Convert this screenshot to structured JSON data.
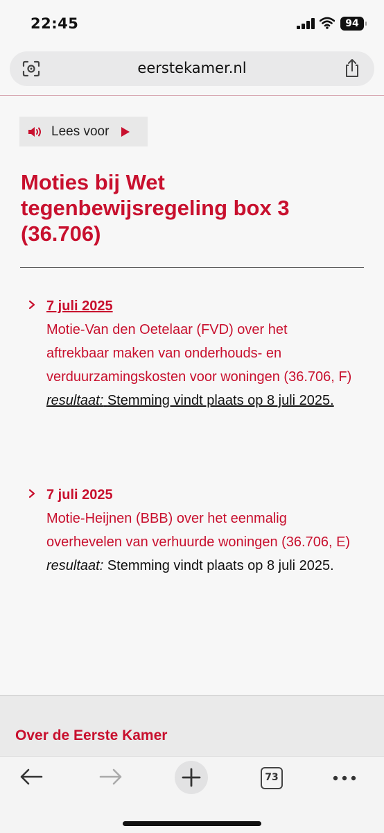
{
  "status_bar": {
    "time": "22:45",
    "battery": "94"
  },
  "browser": {
    "url": "eerstekamer.nl",
    "tab_count": "73"
  },
  "lees_voor": {
    "label": "Lees voor"
  },
  "page": {
    "title": "Moties bij Wet tegenbewijsregeling box 3 (36.706)"
  },
  "moties": [
    {
      "date": "7 juli 2025",
      "description": "Motie-Van den Oetelaar (FVD) over het aftrekbaar maken van onderhouds- en verduurzamingskosten voor woningen (36.706, F)",
      "result_label": "resultaat:",
      "result_text": "Stemming vindt plaats op 8 juli 2025."
    },
    {
      "date": "7 juli 2025",
      "description": "Motie-Heijnen (BBB) over het eenmalig overhevelen van verhuurde woningen (36.706, E)",
      "result_label": "resultaat:",
      "result_text": "Stemming vindt plaats op 8 juli 2025."
    }
  ],
  "footer": {
    "link": "Over de Eerste Kamer"
  },
  "colors": {
    "accent": "#c8102e"
  }
}
